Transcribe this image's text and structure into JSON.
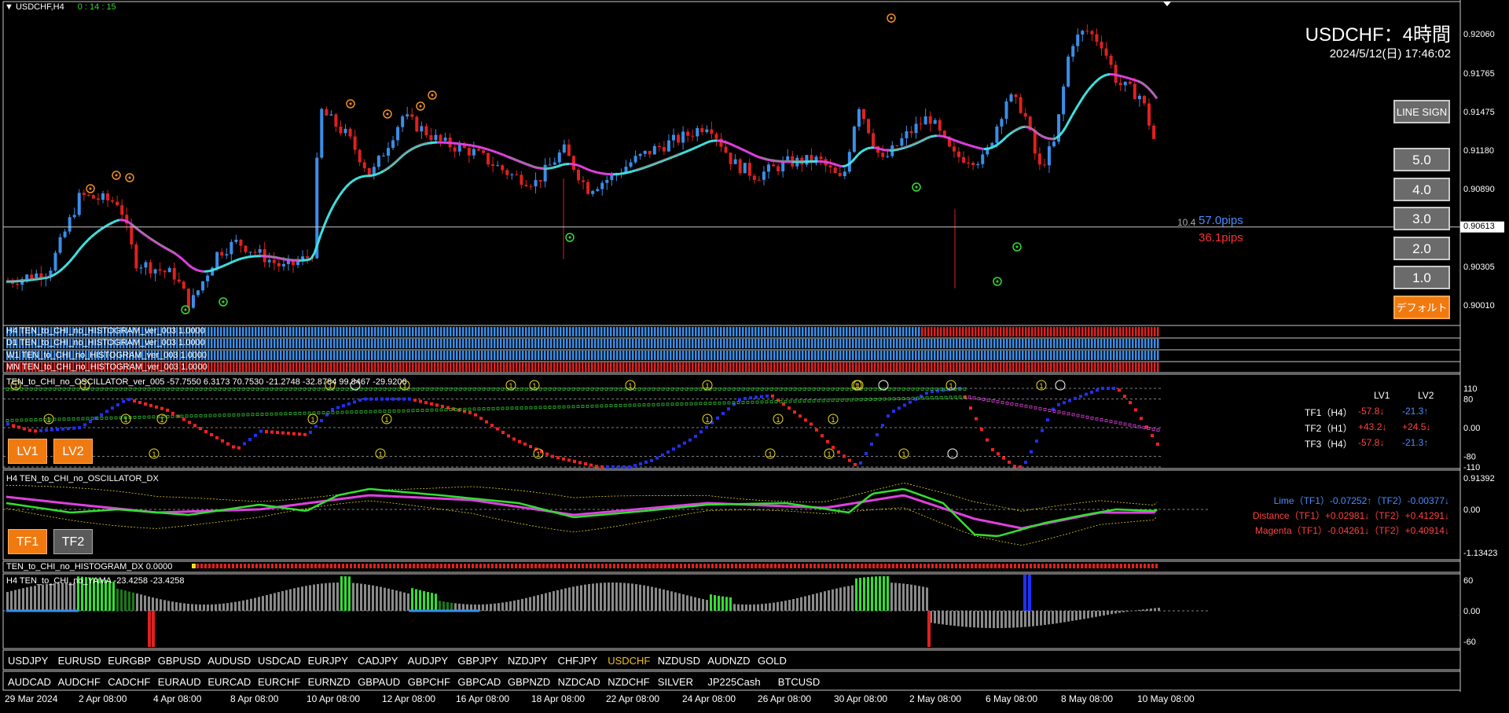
{
  "window": {
    "symbol_title": "USDCHF,H4",
    "timer": "0 : 14 : 15",
    "big_title": "USDCHF：4時間",
    "datetime": "2024/5/12(日) 17:46:02"
  },
  "price_axis": {
    "labels": [
      "0.92060",
      "0.91765",
      "0.91475",
      "0.91180",
      "0.90890",
      "0.90613",
      "0.90305",
      "0.90010"
    ],
    "current_price": "0.90613"
  },
  "pips": {
    "prefix": "10.4",
    "up": "57.0pips",
    "down": "36.1pips"
  },
  "buttons": {
    "line_sign": "LINE SIGN",
    "levels": [
      "5.0",
      "4.0",
      "3.0",
      "2.0",
      "1.0"
    ],
    "default": "デフォルト",
    "lv1": "LV1",
    "lv2": "LV2",
    "tf1": "TF1",
    "tf2": "TF2"
  },
  "histograms": [
    "H4 TEN_to_CHI_no_HISTOGRAM_ver_003 1.0000",
    "D1 TEN_to_CHI_no_HISTOGRAM_ver_003 1.0000",
    "W1 TEN_to_CHI_no_HISTOGRAM_ver_003 1.0000",
    "MN TEN_to_CHI_no_HISTOGRAM_ver_003 1.0000"
  ],
  "oscillator": {
    "title": "TEN_to_CHI_no_OSCILLATOR_ver_005 -57.7550 6.3173 70.7530 -21.2748 -32.8784 99.8467 -29.9206",
    "axis": [
      "110",
      "80",
      "0.00",
      "-80",
      "-110"
    ],
    "header_lv1": "LV1",
    "header_lv2": "LV2",
    "rows": [
      {
        "tf": "TF1（H4）",
        "lv1": "-57.8↓",
        "lv2": "-21.3↑",
        "lv1_color": "#ff4040",
        "lv2_color": "#4a8cff"
      },
      {
        "tf": "TF2（H1）",
        "lv1": "+43.2↓",
        "lv2": "+24.5↓",
        "lv1_color": "#ff4040",
        "lv2_color": "#ff4040"
      },
      {
        "tf": "TF3（H4）",
        "lv1": "-57.8↓",
        "lv2": "-21.3↑",
        "lv1_color": "#ff4040",
        "lv2_color": "#4a8cff"
      }
    ]
  },
  "dx": {
    "title": "H4 TEN_to_CHI_no_OSCILLATOR_DX",
    "axis": [
      "0.91392",
      "0.00",
      "-1.13423"
    ],
    "lines": [
      {
        "text": "Lime（TF1）-0.07252↑（TF2）-0.00377↓",
        "color": "#4a8cff"
      },
      {
        "text": "Distance（TF1）+0.02981↓（TF2）+0.41291↓",
        "color": "#ff4040"
      },
      {
        "text": "Magenta（TF1）-0.04261↓（TF2）+0.40914↓",
        "color": "#ff4040"
      }
    ]
  },
  "histogram_dx": {
    "title": "TEN_to_CHI_no_HISTOGRAM_DX 0.0000"
  },
  "yama": {
    "title": "H4  TEN_to_CHI_no_YAMA -23.4258 -23.4258",
    "axis": [
      "60",
      "0.00",
      "-60"
    ]
  },
  "pairs_row1": [
    "USDJPY",
    "EURUSD",
    "EURGBP",
    "GBPUSD",
    "AUDUSD",
    "USDCAD",
    "EURJPY",
    "CADJPY",
    "AUDJPY",
    "GBPJPY",
    "NZDJPY",
    "CHFJPY",
    "USDCHF",
    "NZDUSD",
    "AUDNZD",
    "GOLD"
  ],
  "pairs_row1_active": "USDCHF",
  "pairs_row2": [
    "AUDCAD",
    "AUDCHF",
    "CADCHF",
    "EURAUD",
    "EURCAD",
    "EURCHF",
    "EURNZD",
    "GBPAUD",
    "GBPCHF",
    "GBPCAD",
    "GBPNZD",
    "NZDCAD",
    "NZDCHF",
    "SILVER",
    "JP225Cash",
    "BTCUSD"
  ],
  "time_axis": [
    "29 Mar 2024",
    "2 Apr 08:00",
    "4 Apr 08:00",
    "8 Apr 08:00",
    "10 Apr 08:00",
    "12 Apr 08:00",
    "16 Apr 08:00",
    "18 Apr 08:00",
    "22 Apr 08:00",
    "24 Apr 08:00",
    "26 Apr 08:00",
    "30 Apr 08:00",
    "2 May 08:00",
    "6 May 08:00",
    "8 May 08:00",
    "10 May 08:00"
  ],
  "colors": {
    "bull": "#3a8ee8",
    "bear": "#e02020",
    "ma_up": "#40e0e0",
    "ma_down": "#e040e0",
    "lime": "#30e030"
  }
}
